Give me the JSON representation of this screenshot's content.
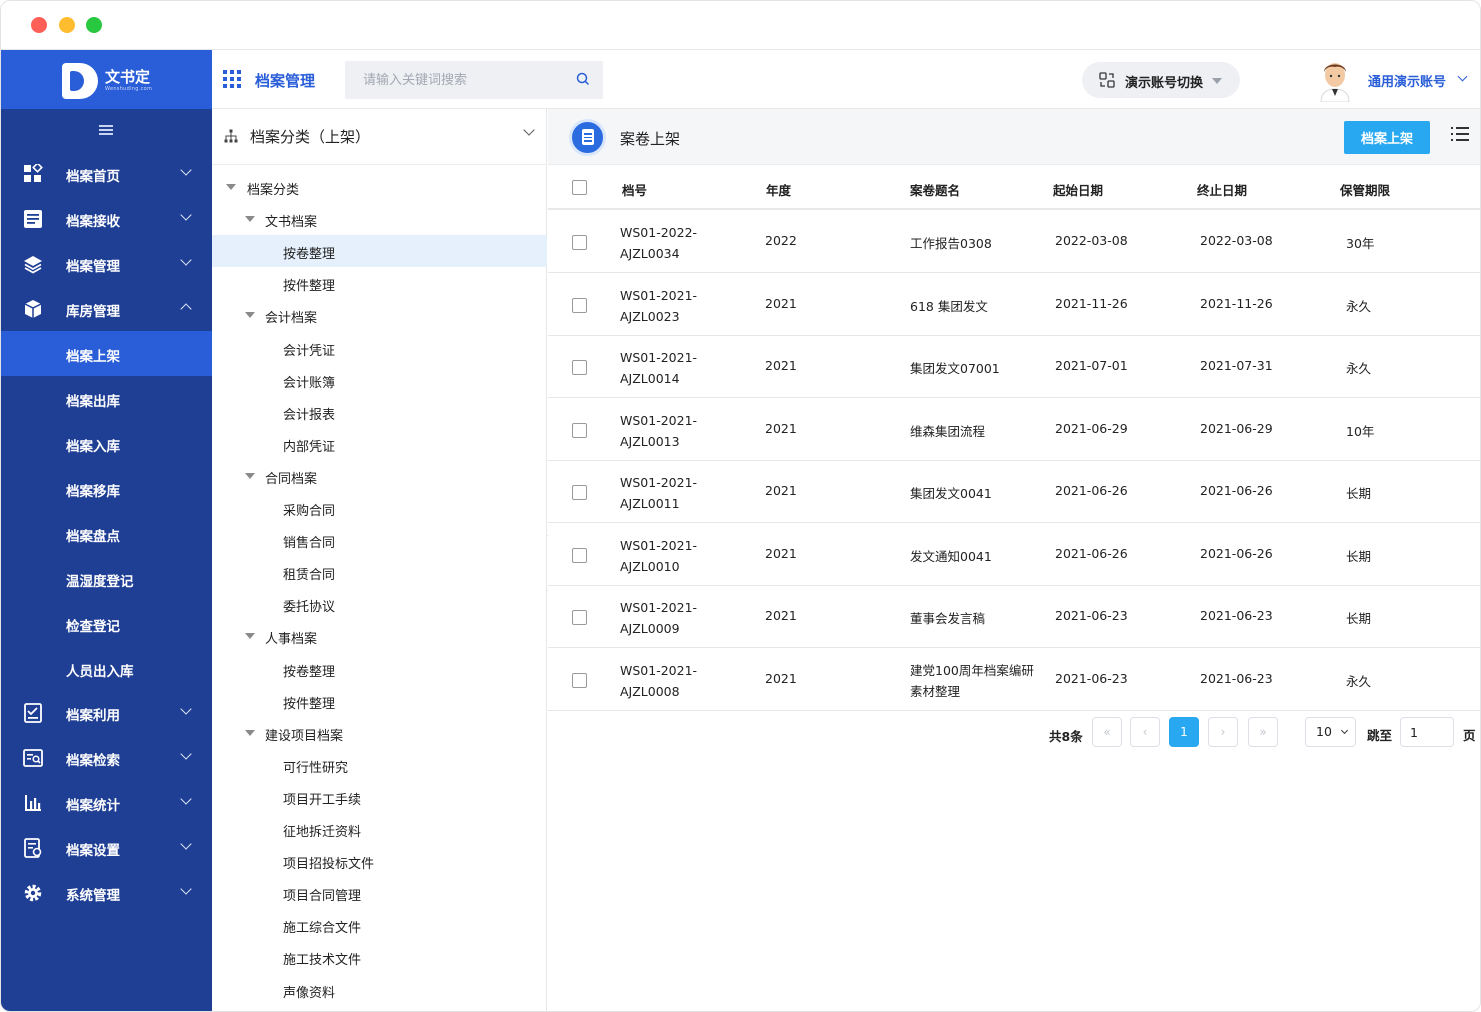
{
  "logo": {
    "name": "文书定",
    "sub": "Wenshuding.com"
  },
  "header": {
    "title": "档案管理",
    "search_placeholder": "请输入关键词搜索",
    "switch_label": "演示账号切换",
    "user_name": "通用演示账号"
  },
  "sidebar": {
    "items": [
      {
        "label": "档案首页",
        "icon": "home-grid-icon"
      },
      {
        "label": "档案接收",
        "icon": "inbox-list-icon"
      },
      {
        "label": "档案管理",
        "icon": "layers-icon"
      },
      {
        "label": "库房管理",
        "icon": "box-icon"
      },
      {
        "label": "档案利用",
        "icon": "checklist-icon"
      },
      {
        "label": "档案检索",
        "icon": "search-doc-icon"
      },
      {
        "label": "档案统计",
        "icon": "bar-chart-icon"
      },
      {
        "label": "档案设置",
        "icon": "settings-doc-icon"
      },
      {
        "label": "系统管理",
        "icon": "gear-icon"
      }
    ],
    "sub_items": [
      "档案上架",
      "档案出库",
      "档案入库",
      "档案移库",
      "档案盘点",
      "温湿度登记",
      "检查登记",
      "人员出入库"
    ]
  },
  "tree": {
    "header": "档案分类（上架）",
    "nodes": [
      "档案分类",
      "文书档案",
      "按卷整理",
      "按件整理",
      "会计档案",
      "会计凭证",
      "会计账簿",
      "会计报表",
      "内部凭证",
      "合同档案",
      "采购合同",
      "销售合同",
      "租赁合同",
      "委托协议",
      "人事档案",
      "按卷整理",
      "按件整理",
      "建设项目档案",
      "可行性研究",
      "项目开工手续",
      "征地拆迁资料",
      "项目招投标文件",
      "项目合同管理",
      "施工综合文件",
      "施工技术文件",
      "声像资料"
    ]
  },
  "main": {
    "title": "案卷上架",
    "primary_button": "档案上架",
    "columns": [
      "档号",
      "年度",
      "案卷题名",
      "起始日期",
      "终止日期",
      "保管期限"
    ],
    "rows": [
      {
        "code1": "WS01-2022-",
        "code2": "AJZL0034",
        "year": "2022",
        "title1": "工作报告0308",
        "title2": "",
        "start": "2022-03-08",
        "end": "2022-03-08",
        "term": "30年"
      },
      {
        "code1": "WS01-2021-",
        "code2": "AJZL0023",
        "year": "2021",
        "title1": "618 集团发文",
        "title2": "",
        "start": "2021-11-26",
        "end": "2021-11-26",
        "term": "永久"
      },
      {
        "code1": "WS01-2021-",
        "code2": "AJZL0014",
        "year": "2021",
        "title1": "集团发文07001",
        "title2": "",
        "start": "2021-07-01",
        "end": "2021-07-31",
        "term": "永久"
      },
      {
        "code1": "WS01-2021-",
        "code2": "AJZL0013",
        "year": "2021",
        "title1": "维森集团流程",
        "title2": "",
        "start": "2021-06-29",
        "end": "2021-06-29",
        "term": "10年"
      },
      {
        "code1": "WS01-2021-",
        "code2": "AJZL0011",
        "year": "2021",
        "title1": "集团发文0041",
        "title2": "",
        "start": "2021-06-26",
        "end": "2021-06-26",
        "term": "长期"
      },
      {
        "code1": "WS01-2021-",
        "code2": "AJZL0010",
        "year": "2021",
        "title1": "发文通知0041",
        "title2": "",
        "start": "2021-06-26",
        "end": "2021-06-26",
        "term": "长期"
      },
      {
        "code1": "WS01-2021-",
        "code2": "AJZL0009",
        "year": "2021",
        "title1": "董事会发言稿",
        "title2": "",
        "start": "2021-06-23",
        "end": "2021-06-23",
        "term": "长期"
      },
      {
        "code1": "WS01-2021-",
        "code2": "AJZL0008",
        "year": "2021",
        "title1": "建党100周年档案编研",
        "title2": "素材整理",
        "start": "2021-06-23",
        "end": "2021-06-23",
        "term": "永久"
      }
    ]
  },
  "pager": {
    "total": "共8条",
    "first": "«",
    "prev": "‹",
    "current": "1",
    "next": "›",
    "last": "»",
    "page_size": "10",
    "jump_label": "跳至",
    "jump_value": "1",
    "page_suffix": "页"
  },
  "colors": {
    "sidebar": "#1f3f95",
    "accent": "#2a5ed8",
    "primary_button": "#29a8f2"
  }
}
